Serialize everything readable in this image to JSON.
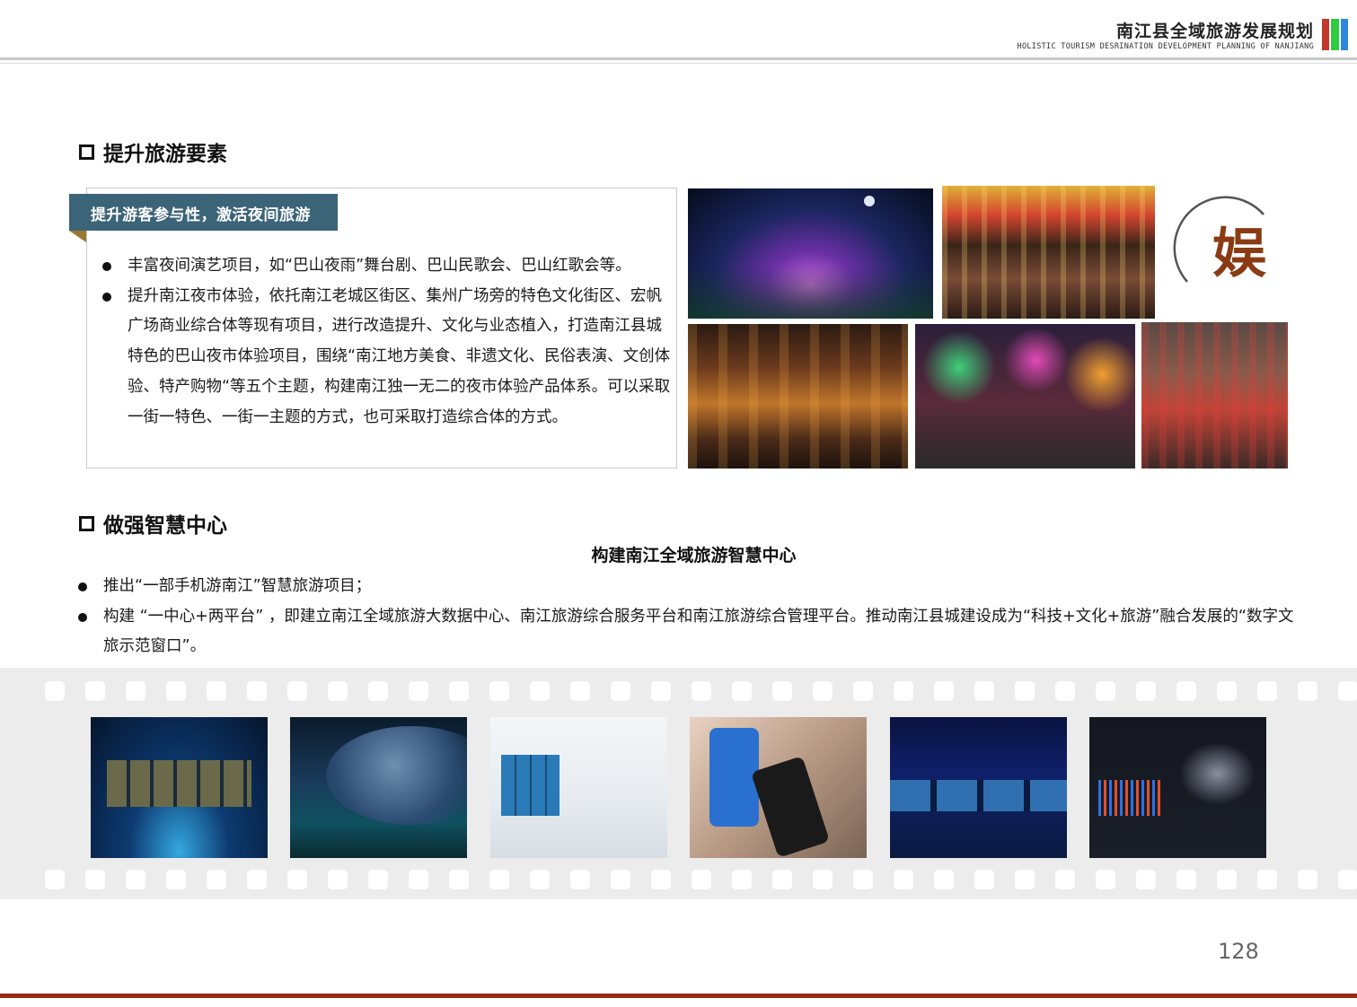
{
  "header": {
    "title": "南江县全域旅游发展规划",
    "subtitle": "HOLISTIC TOURISM DESRINATION DEVELOPMENT PLANNING OF NANJIANG",
    "bar_colors": [
      "#c0392b",
      "#2ecc40",
      "#2e86de"
    ]
  },
  "section1": {
    "heading": "提升旅游要素",
    "ribbon": "提升游客参与性，激活夜间旅游",
    "bullets": [
      "丰富夜间演艺项目，如“巴山夜雨”舞台剧、巴山民歌会、巴山红歌会等。",
      "提升南江夜市体验，依托南江老城区街区、集州广场旁的特色文化街区、宏帆广场商业综合体等现有项目，进行改造提升、文化与业态植入，打造南江县城特色的巴山夜市体验项目，围绕“南江地方美食、非遗文化、民俗表演、文创体验、特产购物“等五个主题，构建南江独一无二的夜市体验产品体系。可以采取一街一特色、一街一主题的方式，也可采取打造综合体的方式。"
    ],
    "badge_char": "娱"
  },
  "section2": {
    "heading": "做强智慧中心",
    "center_title": "构建南江全域旅游智慧中心",
    "bullets": [
      "推出“一部手机游南江”智慧旅游项目；",
      "构建 “一中心+两平台” ，即建立南江全域旅游大数据中心、南江旅游综合服务平台和南江旅游综合管理平台。推动南江县城建设成为“科技+文化+旅游”融合发展的“数字文旅示范窗口”。"
    ]
  },
  "colors": {
    "ribbon": "#3c6478",
    "ribbon_fold": "#9a7a33",
    "badge": "#8a3b14",
    "footer_line": "#9b2a16"
  },
  "footer": {
    "page_number": "128"
  }
}
